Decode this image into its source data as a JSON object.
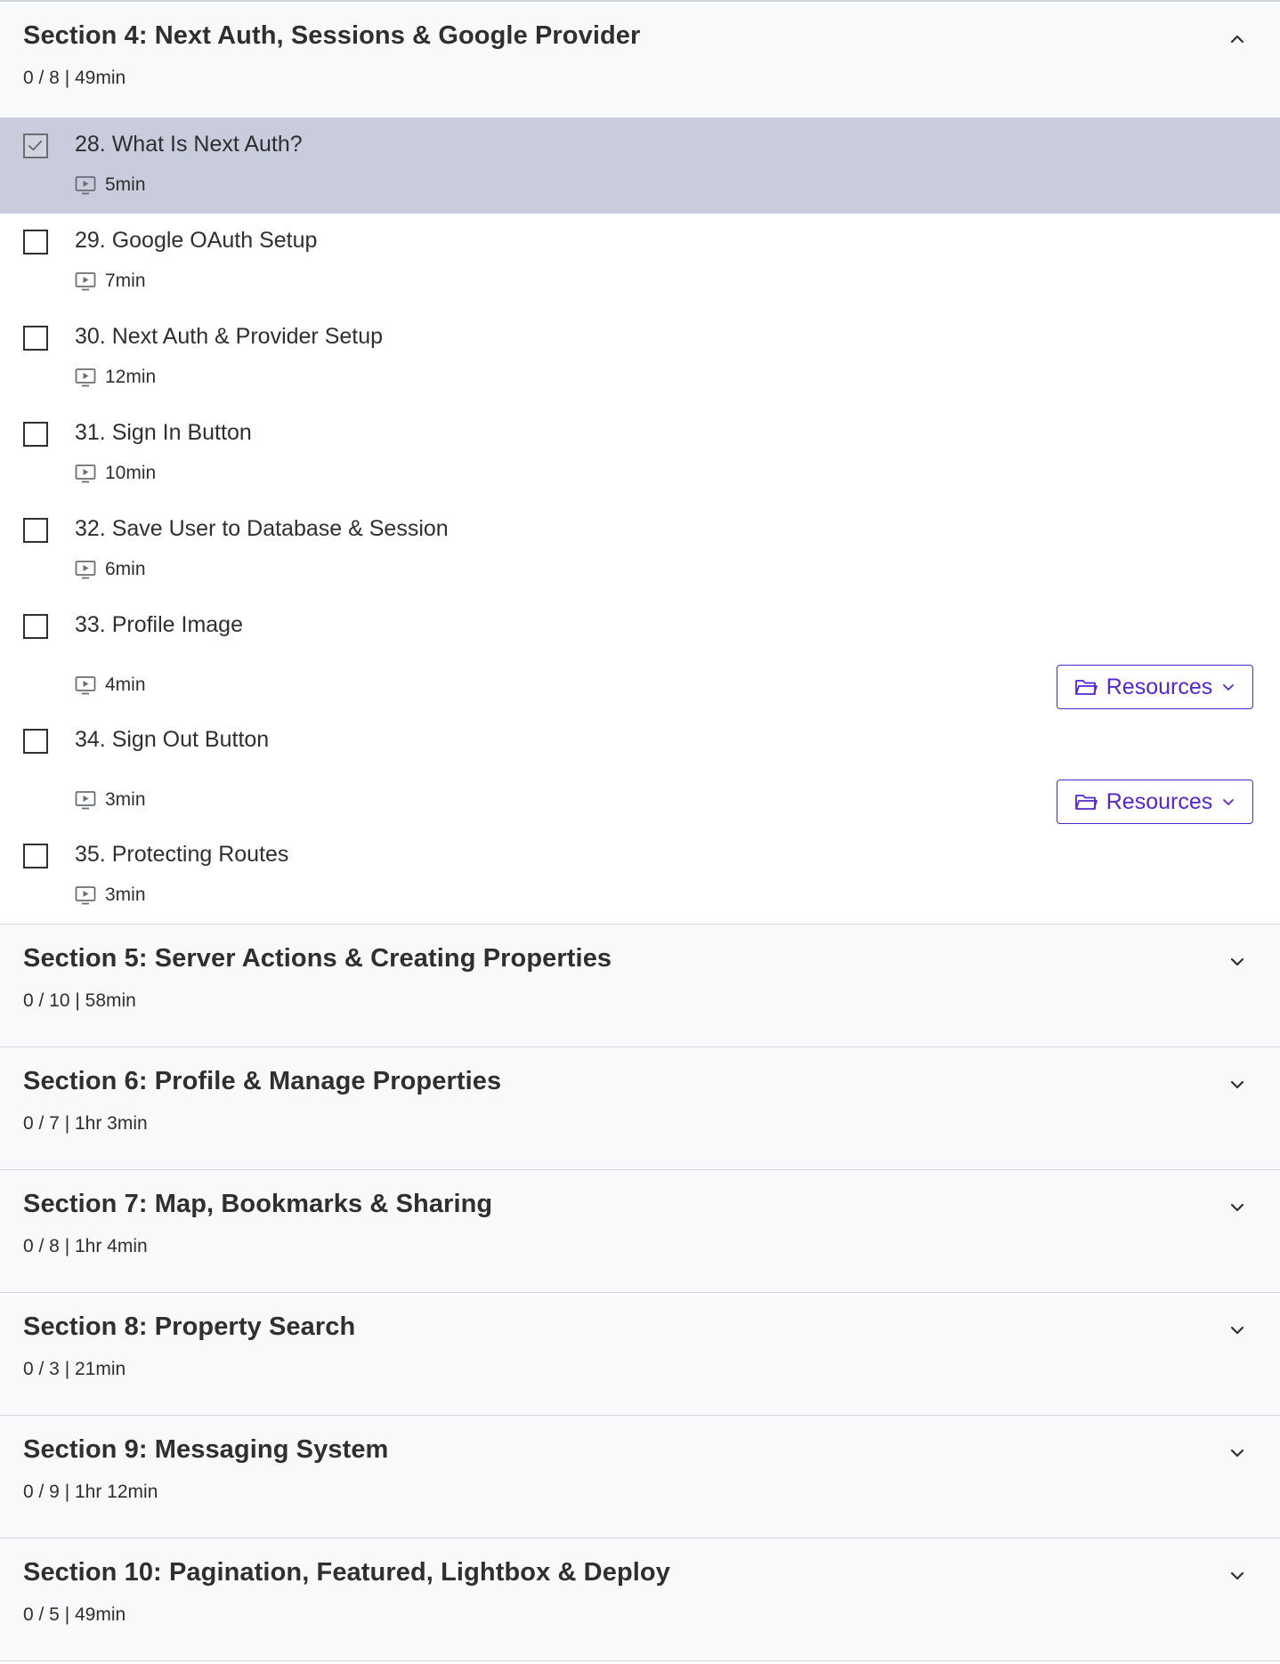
{
  "open_section": {
    "title": "Section 4: Next Auth, Sessions & Google Provider",
    "meta": "0 / 8 | 49min",
    "lectures": [
      {
        "title": "28. What Is Next Auth?",
        "duration": "5min",
        "current": true,
        "resources": false
      },
      {
        "title": "29. Google OAuth Setup",
        "duration": "7min",
        "current": false,
        "resources": false
      },
      {
        "title": "30. Next Auth & Provider Setup",
        "duration": "12min",
        "current": false,
        "resources": false
      },
      {
        "title": "31. Sign In Button",
        "duration": "10min",
        "current": false,
        "resources": false
      },
      {
        "title": "32. Save User to Database & Session",
        "duration": "6min",
        "current": false,
        "resources": false
      },
      {
        "title": "33. Profile Image",
        "duration": "4min",
        "current": false,
        "resources": true
      },
      {
        "title": "34. Sign Out Button",
        "duration": "3min",
        "current": false,
        "resources": true
      },
      {
        "title": "35. Protecting Routes",
        "duration": "3min",
        "current": false,
        "resources": false
      }
    ]
  },
  "resources_label": "Resources",
  "collapsed_sections": [
    {
      "title": "Section 5: Server Actions & Creating Properties",
      "meta": "0 / 10 | 58min"
    },
    {
      "title": "Section 6: Profile & Manage Properties",
      "meta": "0 / 7 | 1hr 3min"
    },
    {
      "title": "Section 7: Map, Bookmarks & Sharing",
      "meta": "0 / 8 | 1hr 4min"
    },
    {
      "title": "Section 8: Property Search",
      "meta": "0 / 3 | 21min"
    },
    {
      "title": "Section 9: Messaging System",
      "meta": "0 / 9 | 1hr 12min"
    },
    {
      "title": "Section 10: Pagination, Featured, Lightbox & Deploy",
      "meta": "0 / 5 | 49min"
    }
  ],
  "icons": {
    "open_chevron": "chevron-up-icon",
    "collapsed_chevron": "chevron-down-icon",
    "lecture_type": "video-icon",
    "resources": "folder-icon"
  },
  "colors": {
    "accent": "#5624d0",
    "current_row": "#c9ccdc",
    "section_bg": "#f7f9fa"
  }
}
